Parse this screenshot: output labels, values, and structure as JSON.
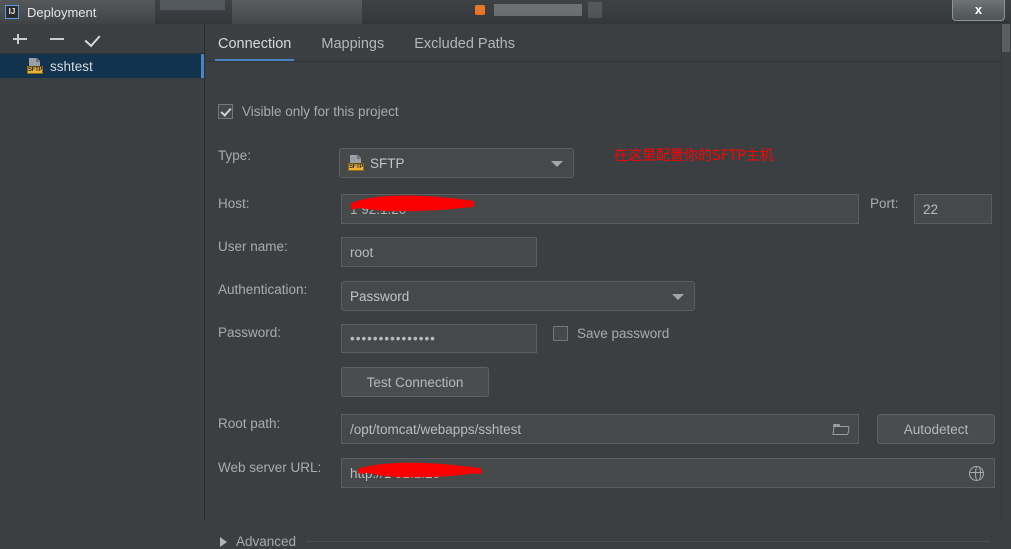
{
  "window": {
    "title": "Deployment",
    "app_icon": "intellij-idea-icon",
    "close_label": "x"
  },
  "sidebar": {
    "toolbar": [
      {
        "name": "add",
        "icon": "plus-icon",
        "label": "+"
      },
      {
        "name": "remove",
        "icon": "minus-icon",
        "label": "−"
      },
      {
        "name": "set-default",
        "icon": "check-icon",
        "label": "✓"
      }
    ],
    "items": [
      {
        "label": "sshtest",
        "icon": "sftp-server-icon",
        "icon_tag": "SFTP",
        "selected": true
      }
    ]
  },
  "main": {
    "tabs": [
      {
        "label": "Connection",
        "active": true
      },
      {
        "label": "Mappings",
        "active": false
      },
      {
        "label": "Excluded Paths",
        "active": false
      }
    ],
    "visible_only": {
      "label": "Visible only for this project",
      "checked": true
    },
    "annotation": "在这里配置你的SFTP主机",
    "annotation_color": "#ff0000",
    "fields": {
      "type": {
        "label": "Type:",
        "value": "SFTP",
        "icon": "sftp-server-icon",
        "icon_tag": "SFTP"
      },
      "host": {
        "label": "Host:",
        "value": "1           92.1.20",
        "redacted": true
      },
      "port": {
        "label": "Port:",
        "value": "22"
      },
      "user_name": {
        "label": "User name:",
        "value": "root"
      },
      "authentication": {
        "label": "Authentication:",
        "value": "Password"
      },
      "password": {
        "label": "Password:",
        "value": "•••••••••••••••"
      },
      "save_password": {
        "label": "Save password",
        "checked": false
      },
      "test_connection": {
        "label": "Test Connection"
      },
      "root_path": {
        "label": "Root path:",
        "value": "/opt/tomcat/webapps/sshtest",
        "browse_icon": "folder-icon"
      },
      "autodetect": {
        "label": "Autodetect"
      },
      "web_server_url": {
        "label": "Web server URL:",
        "value": "http://1   92.1.20",
        "redacted": true,
        "open_icon": "globe-icon"
      }
    },
    "advanced": {
      "label": "Advanced",
      "expanded": false,
      "icon": "chevron-right-icon"
    }
  },
  "colors": {
    "background": "#3c3f41",
    "accent": "#4b83c4",
    "selection": "#12334d",
    "field_bg": "#45494a",
    "text": "#a9acae",
    "annotation": "#ff0000",
    "sftp_tag": "#e8b23a"
  }
}
